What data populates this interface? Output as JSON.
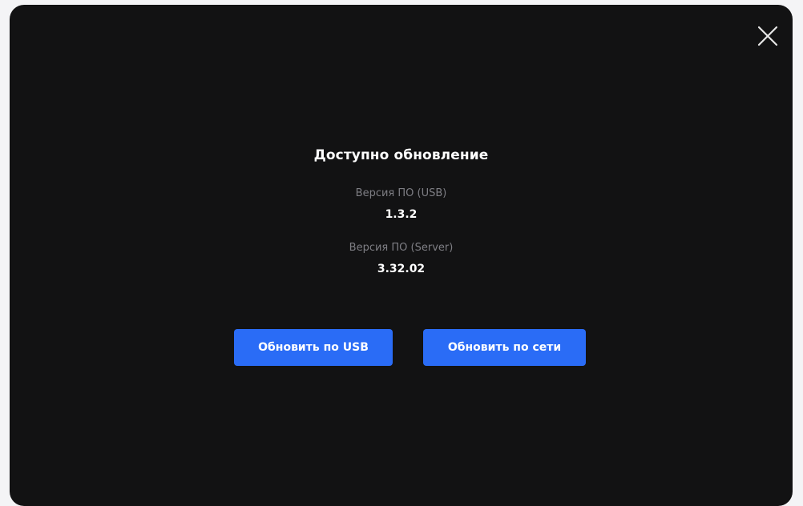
{
  "dialog": {
    "title": "Доступно обновление",
    "usb_version_label": "Версия ПО (USB)",
    "usb_version_value": "1.3.2",
    "server_version_label": "Версия ПО (Server)",
    "server_version_value": "3.32.02",
    "update_usb_label": "Обновить по USB",
    "update_network_label": "Обновить по сети",
    "close_icon": "close-icon"
  },
  "colors": {
    "background": "#121213",
    "accent": "#2a6cf6",
    "muted_text": "#7e7e84",
    "text": "#ffffff"
  }
}
